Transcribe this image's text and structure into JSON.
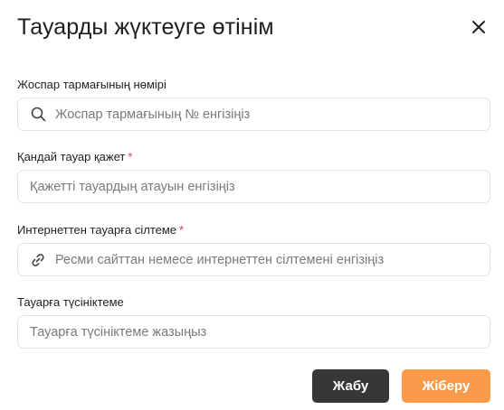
{
  "modal": {
    "title": "Тауарды жүктеуге өтінім",
    "close_icon": "close-icon"
  },
  "fields": {
    "plan_branch": {
      "label": "Жоспар тармағының нөмірі",
      "placeholder": "Жоспар тармағының № енгізіңіз",
      "icon": "search-icon",
      "required": false
    },
    "product_needed": {
      "label": "Қандай тауар қажет",
      "required_mark": "*",
      "placeholder": "Қажетті тауардың атауын енгізіңіз",
      "required": true
    },
    "product_link": {
      "label": "Интернеттен тауарға сілтеме",
      "required_mark": "*",
      "placeholder": "Ресми сайттан немесе интернеттен сілтемені енгізіңіз",
      "icon": "link-icon",
      "required": true
    },
    "product_comment": {
      "label": "Тауарға түсініктеме",
      "placeholder": "Тауарға түсініктеме жазыңыз",
      "required": false
    }
  },
  "buttons": {
    "close_label": "Жабу",
    "send_label": "Жіберу"
  },
  "colors": {
    "accent": "#f99b4b",
    "dark_button": "#373737",
    "required_mark": "#e0345a",
    "input_border": "#e2e2e2"
  }
}
